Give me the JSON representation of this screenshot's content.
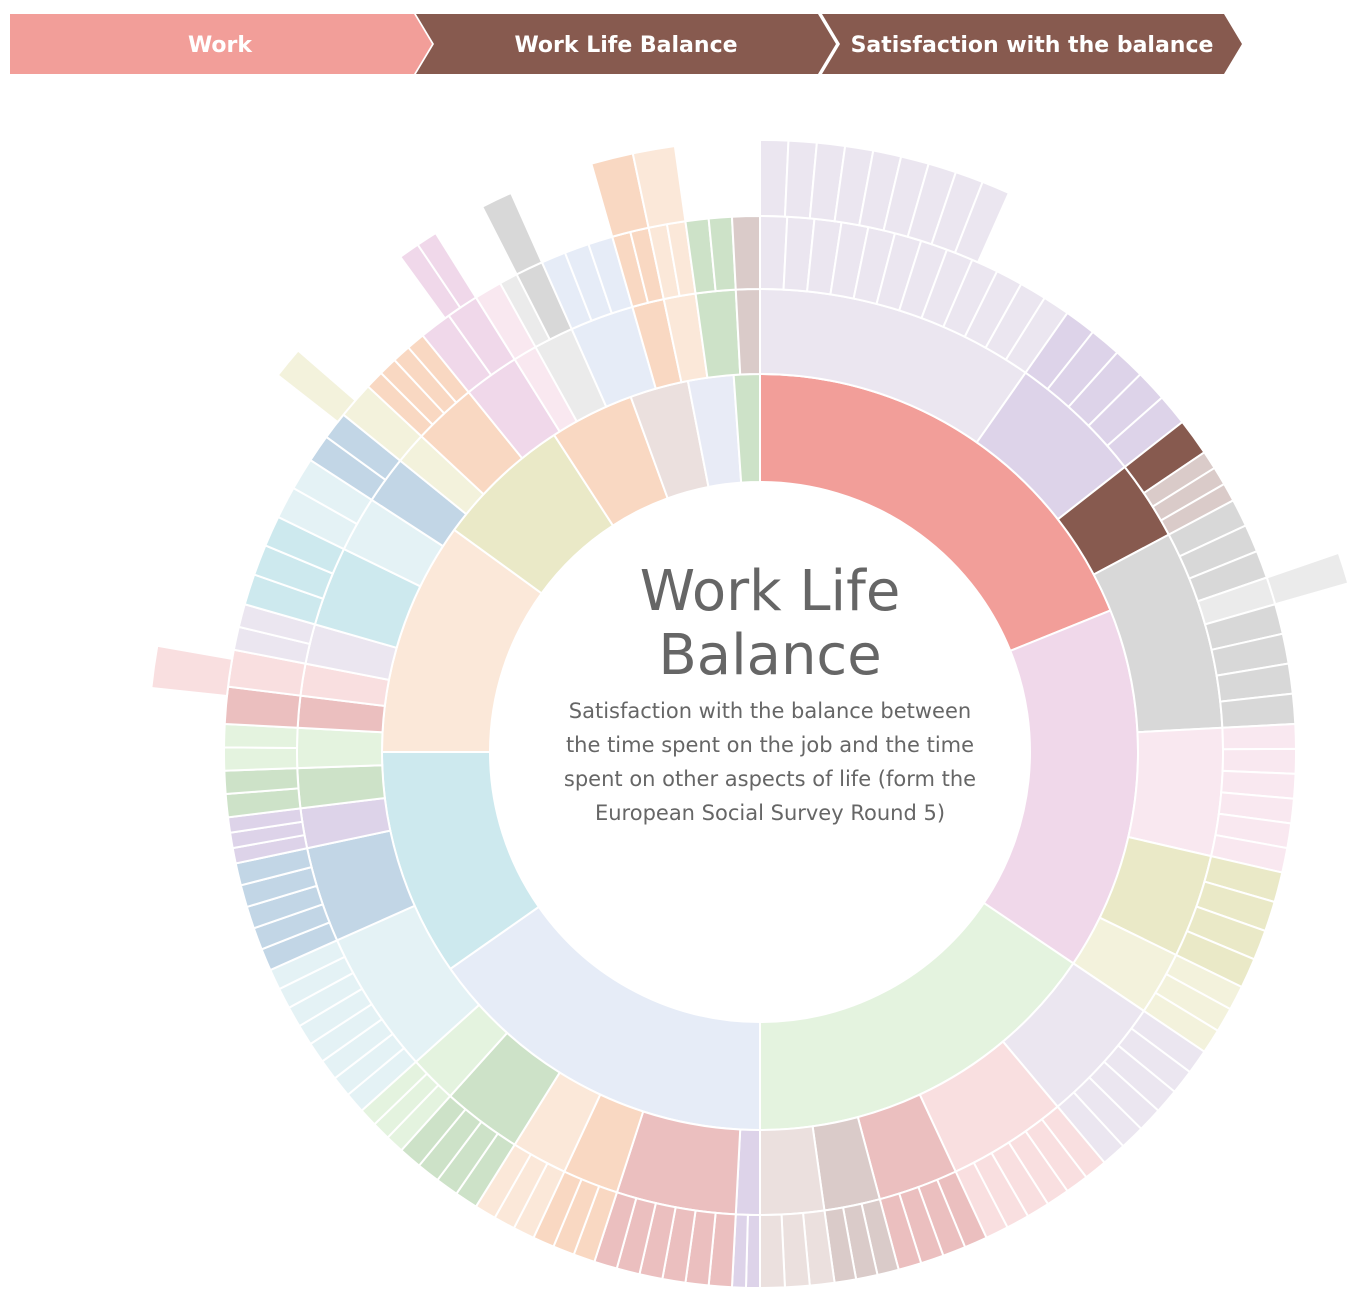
{
  "breadcrumb": [
    {
      "label": "Work",
      "color": "#f29e99"
    },
    {
      "label": "Work Life Balance",
      "color": "#875a4f"
    },
    {
      "label": "Satisfaction with the balance",
      "color": "#875a4f"
    }
  ],
  "center": {
    "title": "Work Life Balance",
    "description": "Satisfaction with the balance between the time spent on the job and the time spent on other aspects of life (form the European Social Survey Round 5)"
  },
  "chart_data": {
    "type": "sunburst",
    "title": "Work Life Balance",
    "levels": 4,
    "segments": [
      {
        "level": 1,
        "start": 0,
        "end": 68,
        "color": "#f29e99"
      },
      {
        "level": 1,
        "start": 68,
        "end": 124,
        "color": "#f0d8ea"
      },
      {
        "level": 1,
        "start": 124,
        "end": 180,
        "color": "#e4f3df"
      },
      {
        "level": 1,
        "start": 180,
        "end": 235,
        "color": "#e6ecf7"
      },
      {
        "level": 1,
        "start": 235,
        "end": 270,
        "color": "#cde9ee"
      },
      {
        "level": 1,
        "start": 270,
        "end": 306,
        "color": "#fbe8d9"
      },
      {
        "level": 1,
        "start": 306,
        "end": 327,
        "color": "#eae9c7"
      },
      {
        "level": 1,
        "start": 327,
        "end": 340,
        "color": "#f9d8c2"
      },
      {
        "level": 1,
        "start": 340,
        "end": 349,
        "color": "#ebe0de"
      },
      {
        "level": 1,
        "start": 349,
        "end": 356,
        "color": "#e8ebf6"
      },
      {
        "level": 1,
        "start": 356,
        "end": 360,
        "color": "#cde2c8"
      },
      {
        "level": 2,
        "start": 0,
        "end": 35,
        "color": "#ebe6f0"
      },
      {
        "level": 2,
        "start": 35,
        "end": 52,
        "color": "#ddd3e9"
      },
      {
        "level": 2,
        "start": 52,
        "end": 62,
        "color": "#875a4f"
      },
      {
        "level": 2,
        "start": 62,
        "end": 87,
        "color": "#d8d8d8"
      },
      {
        "level": 2,
        "start": 87,
        "end": 103,
        "color": "#f9e8f0"
      },
      {
        "level": 2,
        "start": 103,
        "end": 116,
        "color": "#eae9c7"
      },
      {
        "level": 2,
        "start": 116,
        "end": 124,
        "color": "#f3f2dc"
      },
      {
        "level": 2,
        "start": 124,
        "end": 140,
        "color": "#ebe6f0"
      },
      {
        "level": 2,
        "start": 140,
        "end": 155,
        "color": "#f9dfe0"
      },
      {
        "level": 2,
        "start": 155,
        "end": 165,
        "color": "#ebbfbf"
      },
      {
        "level": 2,
        "start": 165,
        "end": 172,
        "color": "#dacbc9"
      },
      {
        "level": 2,
        "start": 172,
        "end": 180,
        "color": "#ebe0de"
      },
      {
        "level": 2,
        "start": 180,
        "end": 183,
        "color": "#ddd3e9"
      },
      {
        "level": 2,
        "start": 183,
        "end": 198,
        "color": "#ebbfbf"
      },
      {
        "level": 2,
        "start": 198,
        "end": 205,
        "color": "#f9d8c2"
      },
      {
        "level": 2,
        "start": 205,
        "end": 212,
        "color": "#fbe8d9"
      },
      {
        "level": 2,
        "start": 212,
        "end": 222,
        "color": "#cde2c8"
      },
      {
        "level": 2,
        "start": 222,
        "end": 228,
        "color": "#e4f3df"
      },
      {
        "level": 2,
        "start": 228,
        "end": 246,
        "color": "#e4f2f5"
      },
      {
        "level": 2,
        "start": 246,
        "end": 258,
        "color": "#c2d6e6"
      },
      {
        "level": 2,
        "start": 258,
        "end": 263,
        "color": "#ddd3e9"
      },
      {
        "level": 2,
        "start": 263,
        "end": 268,
        "color": "#cde2c8"
      },
      {
        "level": 2,
        "start": 268,
        "end": 273,
        "color": "#e4f3df"
      },
      {
        "level": 2,
        "start": 273,
        "end": 277,
        "color": "#ebbfbf"
      },
      {
        "level": 2,
        "start": 277,
        "end": 281,
        "color": "#f9dfe0"
      },
      {
        "level": 2,
        "start": 281,
        "end": 286,
        "color": "#ebe6f0"
      },
      {
        "level": 2,
        "start": 286,
        "end": 296,
        "color": "#cde9ee"
      },
      {
        "level": 2,
        "start": 296,
        "end": 303,
        "color": "#e4f2f5"
      },
      {
        "level": 2,
        "start": 303,
        "end": 309,
        "color": "#c2d6e6"
      },
      {
        "level": 2,
        "start": 309,
        "end": 313,
        "color": "#f3f2dc"
      },
      {
        "level": 2,
        "start": 313,
        "end": 321,
        "color": "#f9d8c2"
      },
      {
        "level": 2,
        "start": 321,
        "end": 328,
        "color": "#f0d8ea"
      },
      {
        "level": 2,
        "start": 328,
        "end": 331,
        "color": "#f9e8f0"
      },
      {
        "level": 2,
        "start": 331,
        "end": 336,
        "color": "#ebebeb"
      },
      {
        "level": 2,
        "start": 336,
        "end": 344,
        "color": "#e6ecf7"
      },
      {
        "level": 2,
        "start": 344,
        "end": 348,
        "color": "#f9d8c2"
      },
      {
        "level": 2,
        "start": 348,
        "end": 352,
        "color": "#fbe8d9"
      },
      {
        "level": 2,
        "start": 352,
        "end": 357,
        "color": "#cde2c8"
      },
      {
        "level": 2,
        "start": 357,
        "end": 360,
        "color": "#dacbc9"
      },
      {
        "level": 3,
        "start": 0,
        "end": 35,
        "color": "#ebe6f0",
        "div": 12
      },
      {
        "level": 3,
        "start": 35,
        "end": 52,
        "color": "#ddd3e9",
        "div": 5
      },
      {
        "level": 3,
        "start": 52,
        "end": 56,
        "color": "#875a4f",
        "div": 1
      },
      {
        "level": 3,
        "start": 56,
        "end": 62,
        "color": "#dacbc9",
        "div": 3
      },
      {
        "level": 3,
        "start": 62,
        "end": 71,
        "color": "#d8d8d8",
        "div": 3
      },
      {
        "level": 3,
        "start": 71,
        "end": 74,
        "color": "#ebebeb",
        "div": 1
      },
      {
        "level": 3,
        "start": 74,
        "end": 87,
        "color": "#d8d8d8",
        "div": 4
      },
      {
        "level": 3,
        "start": 87,
        "end": 103,
        "color": "#f9e8f0",
        "div": 6
      },
      {
        "level": 3,
        "start": 103,
        "end": 116,
        "color": "#eae9c7",
        "div": 4
      },
      {
        "level": 3,
        "start": 116,
        "end": 124,
        "color": "#f3f2dc",
        "div": 3
      },
      {
        "level": 3,
        "start": 124,
        "end": 140,
        "color": "#ebe6f0",
        "div": 6
      },
      {
        "level": 3,
        "start": 140,
        "end": 155,
        "color": "#f9dfe0",
        "div": 6
      },
      {
        "level": 3,
        "start": 155,
        "end": 165,
        "color": "#ebbfbf",
        "div": 4
      },
      {
        "level": 3,
        "start": 165,
        "end": 172,
        "color": "#dacbc9",
        "div": 3
      },
      {
        "level": 3,
        "start": 172,
        "end": 180,
        "color": "#ebe0de",
        "div": 3
      },
      {
        "level": 3,
        "start": 180,
        "end": 183,
        "color": "#ddd3e9",
        "div": 2
      },
      {
        "level": 3,
        "start": 183,
        "end": 198,
        "color": "#ebbfbf",
        "div": 6
      },
      {
        "level": 3,
        "start": 198,
        "end": 205,
        "color": "#f9d8c2",
        "div": 3
      },
      {
        "level": 3,
        "start": 205,
        "end": 212,
        "color": "#fbe8d9",
        "div": 3
      },
      {
        "level": 3,
        "start": 212,
        "end": 222,
        "color": "#cde2c8",
        "div": 4
      },
      {
        "level": 3,
        "start": 222,
        "end": 228,
        "color": "#e4f3df",
        "div": 3
      },
      {
        "level": 3,
        "start": 228,
        "end": 246,
        "color": "#e4f2f5",
        "div": 8
      },
      {
        "level": 3,
        "start": 246,
        "end": 258,
        "color": "#c2d6e6",
        "div": 5
      },
      {
        "level": 3,
        "start": 258,
        "end": 263,
        "color": "#ddd3e9",
        "div": 3
      },
      {
        "level": 3,
        "start": 263,
        "end": 268,
        "color": "#cde2c8",
        "div": 2
      },
      {
        "level": 3,
        "start": 268,
        "end": 273,
        "color": "#e4f3df",
        "div": 2
      },
      {
        "level": 3,
        "start": 273,
        "end": 277,
        "color": "#ebbfbf",
        "div": 1
      },
      {
        "level": 3,
        "start": 277,
        "end": 281,
        "color": "#f9dfe0",
        "div": 1
      },
      {
        "level": 3,
        "start": 281,
        "end": 286,
        "color": "#ebe6f0",
        "div": 2
      },
      {
        "level": 3,
        "start": 286,
        "end": 296,
        "color": "#cde9ee",
        "div": 3
      },
      {
        "level": 3,
        "start": 296,
        "end": 303,
        "color": "#e4f2f5",
        "div": 2
      },
      {
        "level": 3,
        "start": 303,
        "end": 309,
        "color": "#c2d6e6",
        "div": 2
      },
      {
        "level": 3,
        "start": 309,
        "end": 313,
        "color": "#f3f2dc",
        "div": 1
      },
      {
        "level": 3,
        "start": 313,
        "end": 321,
        "color": "#f9d8c2",
        "div": 4
      },
      {
        "level": 3,
        "start": 321,
        "end": 328,
        "color": "#f0d8ea",
        "div": 2
      },
      {
        "level": 3,
        "start": 328,
        "end": 331,
        "color": "#f9e8f0",
        "div": 1
      },
      {
        "level": 3,
        "start": 331,
        "end": 333,
        "color": "#ebebeb",
        "div": 1
      },
      {
        "level": 3,
        "start": 333,
        "end": 336,
        "color": "#d8d8d8",
        "div": 1
      },
      {
        "level": 3,
        "start": 336,
        "end": 344,
        "color": "#e6ecf7",
        "div": 3
      },
      {
        "level": 3,
        "start": 344,
        "end": 348,
        "color": "#f9d8c2",
        "div": 2
      },
      {
        "level": 3,
        "start": 348,
        "end": 352,
        "color": "#fbe8d9",
        "div": 2
      },
      {
        "level": 3,
        "start": 352,
        "end": 357,
        "color": "#cde2c8",
        "div": 2
      },
      {
        "level": 3,
        "start": 357,
        "end": 360,
        "color": "#dacbc9",
        "div": 1
      },
      {
        "level": 4,
        "start": 0,
        "end": 24,
        "color": "#ebe6f0",
        "div": 9
      },
      {
        "level": 4,
        "start": 276,
        "end": 280,
        "color": "#f9dfe0",
        "div": 1
      },
      {
        "level": 4,
        "start": 308,
        "end": 311,
        "color": "#f3f2dc",
        "div": 1
      },
      {
        "level": 4,
        "start": 324,
        "end": 328,
        "color": "#f0d8ea",
        "div": 2
      },
      {
        "level": 4,
        "start": 333,
        "end": 336,
        "color": "#d8d8d8",
        "div": 1
      },
      {
        "level": 4,
        "start": 344,
        "end": 348,
        "color": "#f9d8c2",
        "div": 1
      },
      {
        "level": 4,
        "start": 348,
        "end": 352,
        "color": "#fbe8d9",
        "div": 1
      },
      {
        "level": 4,
        "start": 71,
        "end": 74,
        "color": "#ebebeb",
        "div": 1
      }
    ]
  }
}
